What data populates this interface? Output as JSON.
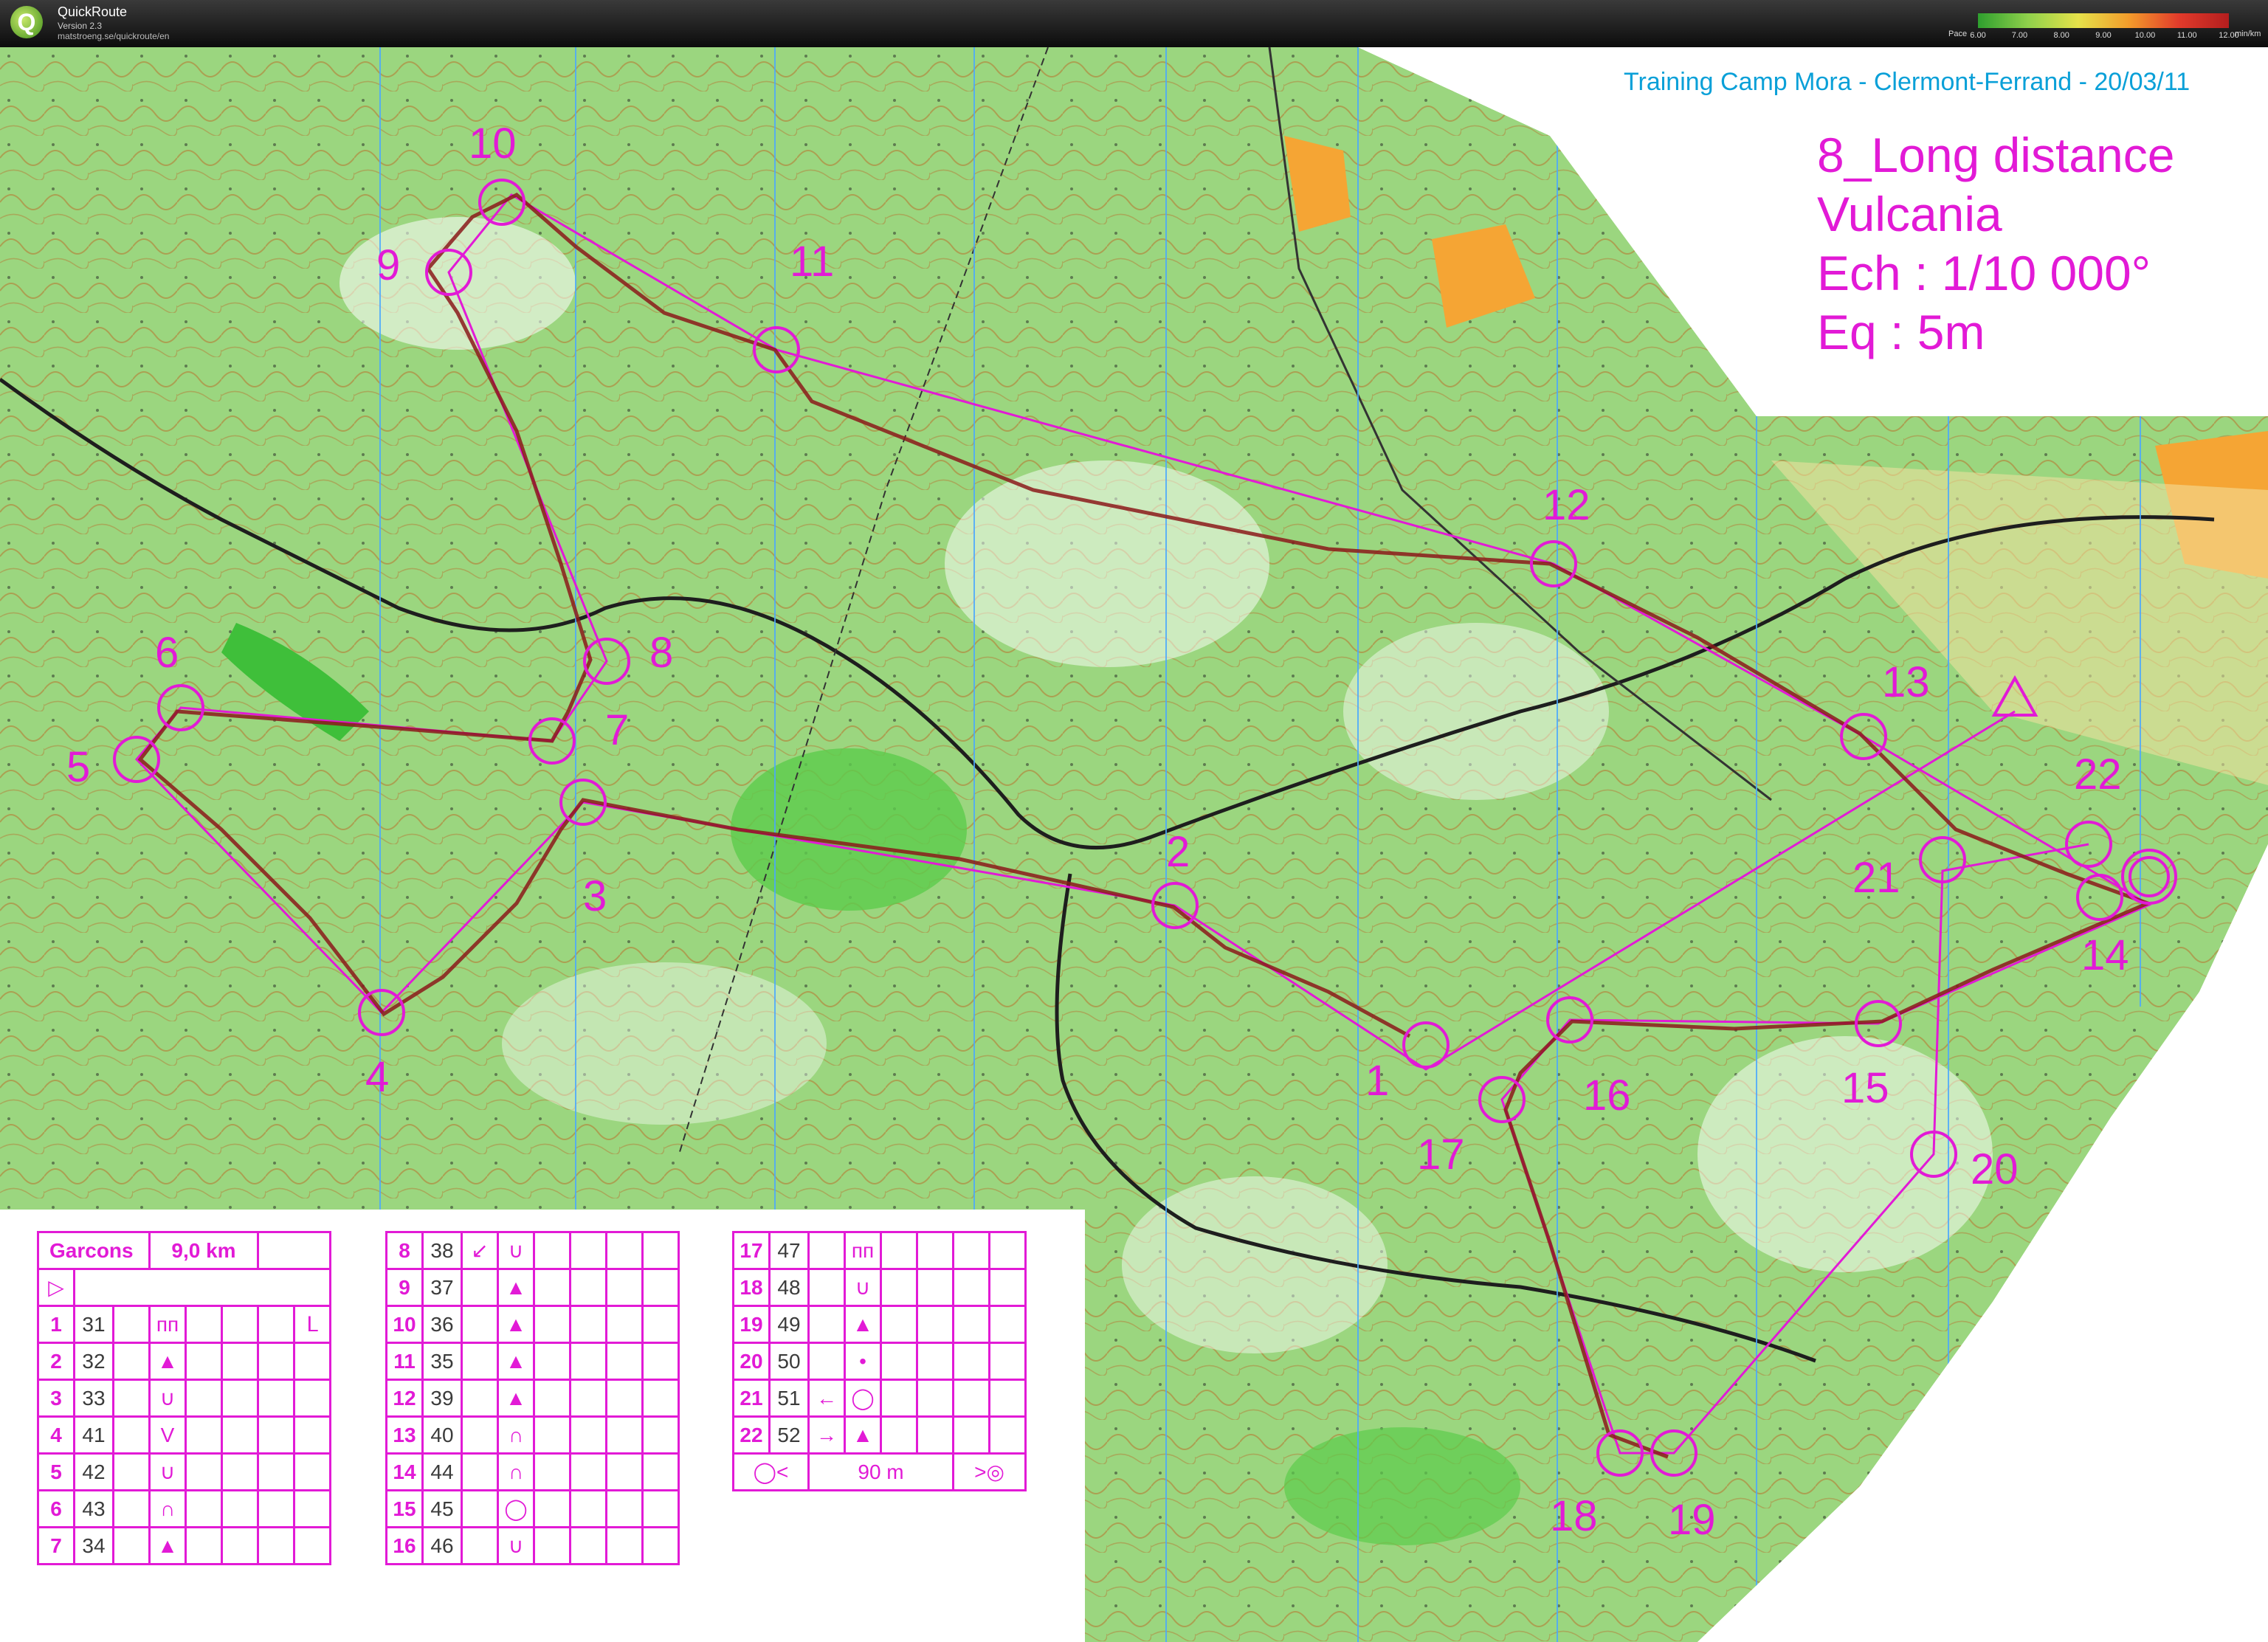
{
  "app": {
    "name": "QuickRoute",
    "version": "Version 2.3",
    "url": "matstroeng.se/quickroute/en"
  },
  "pace_legend": {
    "label": "Pace",
    "ticks": [
      "6.00",
      "7.00",
      "8.00",
      "9.00",
      "10.00",
      "11.00",
      "12.00"
    ],
    "unit": "min/km"
  },
  "map": {
    "credit": "Training Camp Mora - Clermont-Ferrand - 20/03/11",
    "title_lines": [
      "8_Long distance",
      "Vulcania",
      "Ech : 1/10 000°",
      "Eq : 5m"
    ],
    "control_labels": [
      "1",
      "2",
      "3",
      "4",
      "5",
      "6",
      "7",
      "8",
      "9",
      "10",
      "11",
      "12",
      "13",
      "14",
      "15",
      "16",
      "17",
      "18",
      "19",
      "20",
      "21",
      "22"
    ],
    "colors": {
      "course": "#e21ad6",
      "route": "#8b1a1a",
      "forest": "#7ed36a",
      "open": "#ffffff",
      "magnetic_lines": "#4aa8ff"
    }
  },
  "description_sheet": {
    "course": "Garcons",
    "length": "9,0 km",
    "start_symbol": "triangle",
    "rows_a": [
      {
        "n": "1",
        "code": "31",
        "sym": "ᴨᴨ",
        "extra": "ᒪ"
      },
      {
        "n": "2",
        "code": "32",
        "sym": "▲",
        "extra": ""
      },
      {
        "n": "3",
        "code": "33",
        "sym": "∪",
        "extra": ""
      },
      {
        "n": "4",
        "code": "41",
        "sym": "V",
        "extra": ""
      },
      {
        "n": "5",
        "code": "42",
        "sym": "∪",
        "extra": ""
      },
      {
        "n": "6",
        "code": "43",
        "sym": "∩",
        "extra": ""
      },
      {
        "n": "7",
        "code": "34",
        "sym": "▲",
        "extra": ""
      }
    ],
    "rows_b": [
      {
        "n": "8",
        "code": "38",
        "dir": "↙",
        "sym": "∪"
      },
      {
        "n": "9",
        "code": "37",
        "dir": "",
        "sym": "▲"
      },
      {
        "n": "10",
        "code": "36",
        "dir": "",
        "sym": "▲"
      },
      {
        "n": "11",
        "code": "35",
        "dir": "",
        "sym": "▲"
      },
      {
        "n": "12",
        "code": "39",
        "dir": "",
        "sym": "▲"
      },
      {
        "n": "13",
        "code": "40",
        "dir": "",
        "sym": "∩"
      },
      {
        "n": "14",
        "code": "44",
        "dir": "",
        "sym": "∩"
      },
      {
        "n": "15",
        "code": "45",
        "dir": "",
        "sym": "◯"
      },
      {
        "n": "16",
        "code": "46",
        "dir": "",
        "sym": "∪"
      }
    ],
    "rows_c": [
      {
        "n": "17",
        "code": "47",
        "dir": "",
        "sym": "ᴨᴨ"
      },
      {
        "n": "18",
        "code": "48",
        "dir": "",
        "sym": "∪"
      },
      {
        "n": "19",
        "code": "49",
        "dir": "",
        "sym": "▲"
      },
      {
        "n": "20",
        "code": "50",
        "dir": "",
        "sym": "•"
      },
      {
        "n": "21",
        "code": "51",
        "dir": "←",
        "sym": "◯"
      },
      {
        "n": "22",
        "code": "52",
        "dir": "→",
        "sym": "▲"
      }
    ],
    "finish_distance": "90 m"
  }
}
